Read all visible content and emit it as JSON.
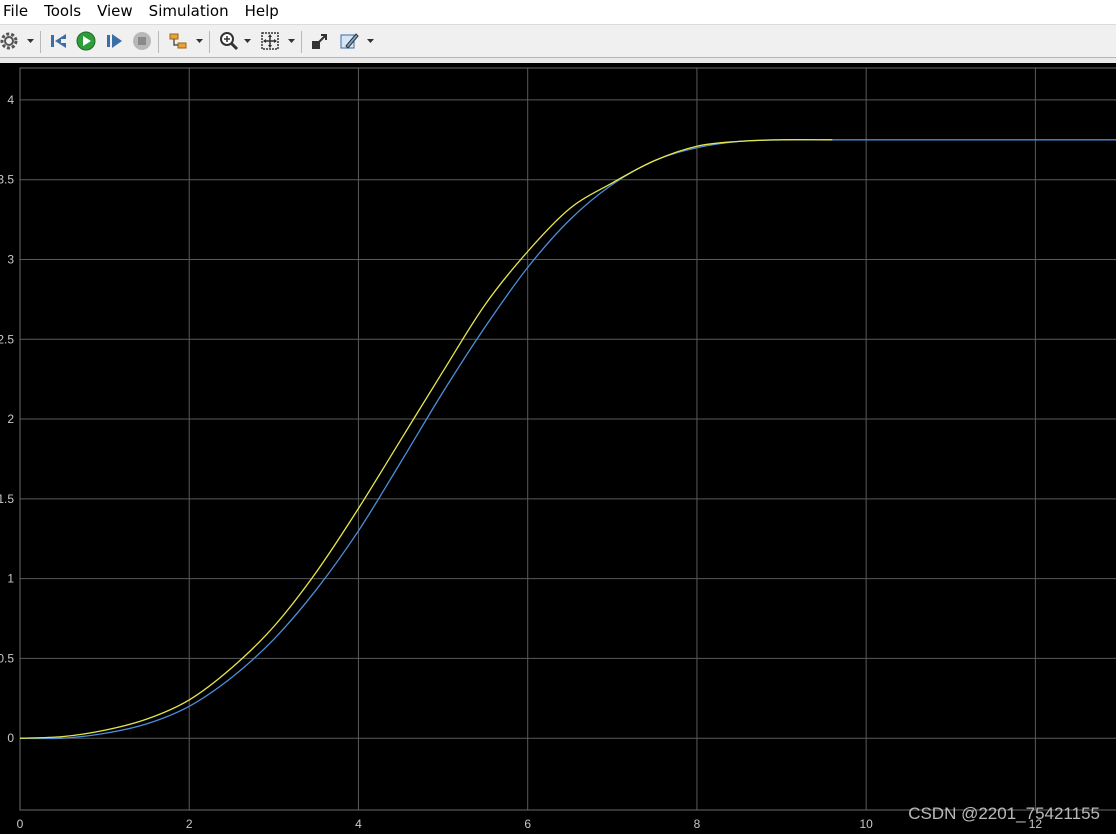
{
  "menu": [
    "File",
    "Tools",
    "View",
    "Simulation",
    "Help"
  ],
  "toolbar": {
    "buttons": [
      "gear-icon",
      "step-back-icon",
      "run-icon",
      "step-forward-icon",
      "stop-icon",
      "signal-selector-icon",
      "zoom-in-icon",
      "fit-to-view-icon",
      "autoscale-icon",
      "highlight-icon"
    ]
  },
  "watermark": "CSDN @2201_75421155",
  "chart_data": {
    "type": "line",
    "title": "",
    "xlabel": "",
    "ylabel": "",
    "xlim": [
      0,
      13
    ],
    "ylim": [
      -0.45,
      4.2
    ],
    "grid": true,
    "x_ticks": [
      "0",
      "2",
      "4",
      "6",
      "8",
      "10",
      "12"
    ],
    "y_ticks": [
      "0",
      "0.5",
      "1",
      "1.5",
      "2",
      "2.5",
      "3",
      "3.5",
      "4"
    ],
    "x": [
      0,
      0.5,
      1,
      1.5,
      2,
      2.5,
      3,
      3.5,
      4,
      4.5,
      5,
      5.5,
      6,
      6.5,
      7,
      7.5,
      8,
      8.5,
      9,
      9.5,
      9.6,
      10,
      11,
      12,
      13
    ],
    "series": [
      {
        "color": "#e6e64c",
        "values": [
          0,
          0.01,
          0.05,
          0.12,
          0.24,
          0.44,
          0.7,
          1.04,
          1.44,
          1.87,
          2.3,
          2.72,
          3.05,
          3.32,
          3.48,
          3.62,
          3.71,
          3.74,
          3.75,
          3.75,
          3.75,
          null,
          null,
          null,
          null
        ]
      },
      {
        "color": "#4c8ed9",
        "values": [
          0,
          0.0,
          0.03,
          0.09,
          0.2,
          0.38,
          0.62,
          0.93,
          1.3,
          1.73,
          2.17,
          2.58,
          2.95,
          3.25,
          3.47,
          3.62,
          3.7,
          3.74,
          3.75,
          3.75,
          3.75,
          3.75,
          3.75,
          3.75,
          3.75
        ]
      }
    ]
  }
}
